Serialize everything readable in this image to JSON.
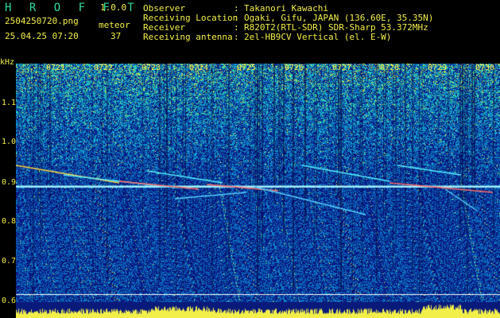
{
  "app": {
    "title": "H R O F F T",
    "version": "1.0.0"
  },
  "file": {
    "name": "2504250720.png",
    "datetime": "25.04.25 07:20"
  },
  "meteor": {
    "label": "meteor",
    "count": "37"
  },
  "info": [
    {
      "label": "Observer",
      "value": "Takanori Kawachi"
    },
    {
      "label": "Receiving Location",
      "value": "Ogaki, Gifu, JAPAN (136.60E, 35.35N)"
    },
    {
      "label": "Receiver",
      "value": "R820T2(RTL-SDR) SDR-Sharp 53.372MHz"
    },
    {
      "label": "Receiving antenna",
      "value": "2el-HB9CV Vertical (el. E-W)"
    }
  ],
  "axis": {
    "unit": "kHz",
    "yticks": [
      "1.1",
      "1.0",
      "0.9",
      "0.8",
      "0.7",
      "0.6"
    ],
    "xticks": [
      "0721",
      "0722",
      "0723",
      "0724",
      "0725",
      "0726",
      "0727",
      "0728",
      "0729",
      "0730"
    ]
  },
  "colors": {
    "text": "#f2ef4a",
    "title": "#2fdc9a",
    "background": "#0a1a7a",
    "carrier": "#9ff0ff"
  }
}
